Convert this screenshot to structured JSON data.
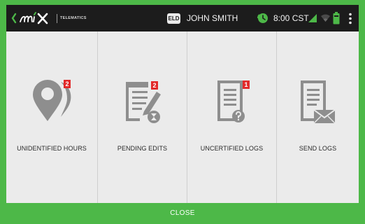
{
  "header": {
    "brand_sub": "TELEMATICS",
    "eld_badge": "ELD",
    "driver_name": "JOHN SMITH",
    "time": "8:00 CST"
  },
  "tiles": [
    {
      "label": "UNIDENTIFIED HOURS",
      "count": "2",
      "icon": "location-pin-icon"
    },
    {
      "label": "PENDING EDITS",
      "count": "2",
      "icon": "document-pencil-icon"
    },
    {
      "label": "UNCERTIFIED LOGS",
      "count": "1",
      "icon": "document-question-icon"
    },
    {
      "label": "SEND LOGS",
      "icon": "document-envelope-icon"
    }
  ],
  "footer": {
    "close_label": "CLOSE"
  },
  "colors": {
    "accent_green": "#4db848",
    "badge_red": "#e22a2a",
    "topbar": "#1c1c1c",
    "tile_bg": "#ebebeb",
    "icon_gray": "#8e8e8e"
  }
}
